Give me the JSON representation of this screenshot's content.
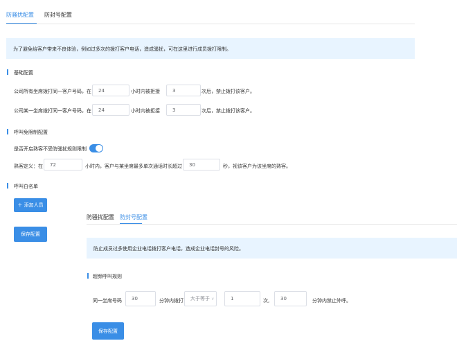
{
  "tabs_top": {
    "anti_harass": "防骚扰配置",
    "anti_block": "防封号配置"
  },
  "banner1": "为了避免给客户带来不良体验，例如过多次的拨打客户电话，造成骚扰，可在这里进行成员拨打限制。",
  "basic": {
    "title": "基础配置",
    "row1": {
      "prefix": "公司所有坐席拨打同一客户号码，在",
      "hours": "24",
      "middle": "小时内被拒接",
      "times": "3",
      "suffix": "次后，禁止拨打该客户。"
    },
    "row2": {
      "prefix": "公司某一坐席拨打同一客户号码，在",
      "hours": "24",
      "middle": "小时内被拒接",
      "times": "3",
      "suffix": "次后，禁止拨打该客户。"
    }
  },
  "exempt": {
    "title": "呼叫免限制配置",
    "toggle_label": "是否开启熟客不受防骚扰规则限制",
    "row": {
      "prefix": "熟客定义：在",
      "hours": "72",
      "middle": "小时内，客户与某坐席最多单次通话时长超过",
      "seconds": "30",
      "suffix": "秒，视该客户为该坐席的熟客。"
    }
  },
  "whitelist": {
    "title": "呼叫白名单",
    "add_button": "＋ 添加人员"
  },
  "save_button_1": "保存配置",
  "overlay": {
    "tab_anti_harass": "防骚扰配置",
    "tab_anti_block": "防封号配置",
    "banner": "防止成员过多使用企业电话拨打客户电话，造成企业电话封号的风险。",
    "section_title": "超频呼叫规则",
    "row": {
      "prefix": "同一坐席号码",
      "minutes": "30",
      "middle": "分钟内拨打",
      "select_value": "大于等于",
      "select_arrow": "∨",
      "count": "1",
      "times_label": "次,",
      "ban_minutes": "30",
      "suffix": "分钟内禁止外呼。"
    },
    "save_button": "保存配置"
  },
  "colors": {
    "accent": "#3a8ee6",
    "banner_bg": "#e8f4ff"
  }
}
